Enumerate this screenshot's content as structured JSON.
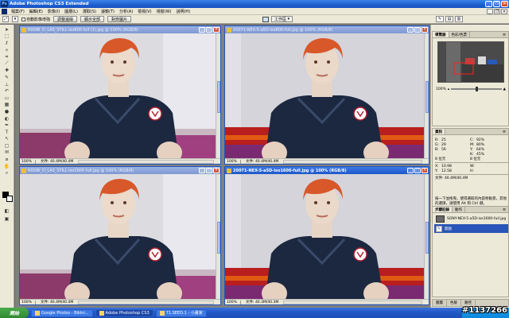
{
  "app": {
    "title": "Adobe Photoshop CS3 Extended",
    "logo": "Ps"
  },
  "menu": [
    "檔案(F)",
    "編輯(E)",
    "影像(I)",
    "圖層(L)",
    "選取(S)",
    "濾鏡(T)",
    "分析(A)",
    "檢視(V)",
    "視窗(W)",
    "說明(H)"
  ],
  "options": {
    "auto_select": "自動影像增強",
    "btn1": "調整邊緣",
    "btn2": "顯示全部",
    "btn3": "對齊圖片",
    "workspace": "工作區"
  },
  "documents": [
    {
      "title": "R0OBI_D_LAS_STILL-iso800 full (1).jpg @ 100% (RGB/8)",
      "zoom": "100%",
      "status": "文件: 40.4M/40.4M"
    },
    {
      "title": "20071-NEX-5-a5D-iso800-full.jpg @ 100% (RGB/8)",
      "zoom": "100%",
      "status": "文件: 40.4M/40.4M"
    },
    {
      "title": "R0OBI_D_LAS_STILL-iso1600 full.jpg @ 100% (RGB/8)",
      "zoom": "100%",
      "status": "文件: 40.4M/40.4M"
    },
    {
      "title": "20071-NEX-5-a5D-iso1600-full.jpg @ 100% (RGB/8)",
      "zoom": "100%",
      "status": "文件: 40.3M/40.3M"
    }
  ],
  "navigator": {
    "tabs": [
      "導覽器",
      "色彩/色票",
      "樣式"
    ],
    "zoom": "100%"
  },
  "info": {
    "tabs": [
      "資訊"
    ],
    "r": "R:",
    "r_val": "25",
    "g": "G:",
    "g_val": "29",
    "b": "B:",
    "b_val": "56",
    "c": "C:",
    "c_val": "92%",
    "m": "M:",
    "m_val": "80%",
    "y": "Y:",
    "y_val": "64%",
    "k": "K:",
    "k_val": "45%",
    "depth1": "8 位元",
    "depth2": "8 位元",
    "x": "X:",
    "x_val": "10.98",
    "y2": "Y:",
    "y2_val": "12.58",
    "w": "W:",
    "h": "H:",
    "doc": "文件: 40.4M/40.4M",
    "hint": "按一下並拖曳，使得選取的內容移動景，其他的選擇，請使用 Alt 和 Ctrl 鍵。"
  },
  "history": {
    "tabs": [
      "步驟記錄",
      "動作"
    ],
    "snapshot": "SONY-NEX-5-a5D-iso1600-full.jpg",
    "step": "開啟"
  },
  "layers_tabs": [
    "圖層",
    "色版",
    "路徑"
  ],
  "taskbar": {
    "start": "開始",
    "tasks": [
      "Google Photos - Bikini...",
      "Adobe Photoshop CS3",
      "71.SEED.1 - 小畫家"
    ]
  },
  "watermark": "#1137266",
  "colors": {
    "xp_blue": "#1f5fd1",
    "workspace_gray": "#808080",
    "panel": "#ece9d8",
    "selection": "#2a55b8"
  }
}
